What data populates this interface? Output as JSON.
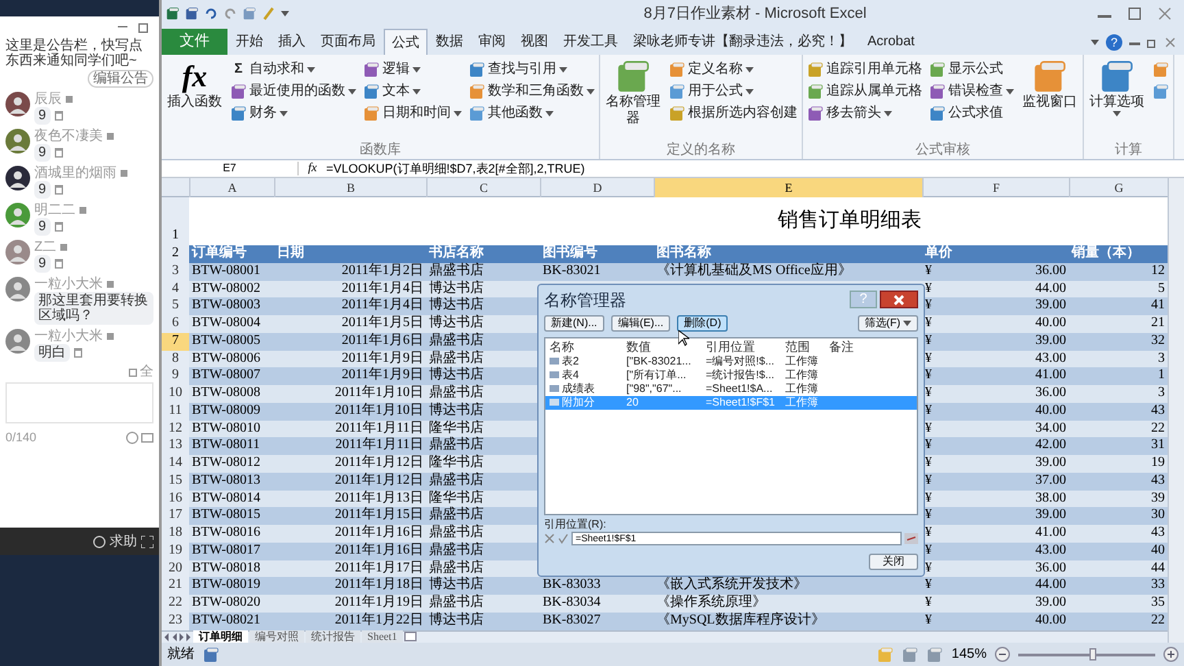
{
  "chat": {
    "announcement": "这里是公告栏，快写点东西来通知同学们吧~",
    "edit_button": "编辑公告",
    "messages": [
      {
        "name": "辰辰",
        "text": "9",
        "deletable": true
      },
      {
        "name": "夜色不凄美",
        "text": "9",
        "deletable": true
      },
      {
        "name": "酒城里的烟雨",
        "text": "9",
        "deletable": true
      },
      {
        "name": "明二二",
        "text": "9",
        "deletable": true
      },
      {
        "name": "Z二",
        "text": "9",
        "deletable": true
      },
      {
        "name": "一粒小大米",
        "text": "那这里套用要转换区域吗？",
        "deletable": false
      },
      {
        "name": "一粒小大米",
        "text": "明白",
        "deletable": true
      }
    ],
    "all_checked": false,
    "all_label": "全",
    "counter": "0/140",
    "help": "求助"
  },
  "excel": {
    "title": "8月7日作业素材 - Microsoft Excel",
    "file_tab": "文件",
    "tabs": [
      {
        "label": "开始",
        "selected": false
      },
      {
        "label": "插入",
        "selected": false
      },
      {
        "label": "页面布局",
        "selected": false
      },
      {
        "label": "公式",
        "selected": true
      },
      {
        "label": "数据",
        "selected": false
      },
      {
        "label": "审阅",
        "selected": false
      },
      {
        "label": "视图",
        "selected": false
      },
      {
        "label": "开发工具",
        "selected": false
      },
      {
        "label": "梁咏老师专讲【翻录违法，必究！】",
        "selected": false
      },
      {
        "label": "Acrobat",
        "selected": false
      }
    ],
    "help_glyph": "?",
    "ribbon": [
      {
        "label": "函数库",
        "items": [
          {
            "kind": "big",
            "label": "插入函数",
            "glyph": "fx",
            "dropdown": false
          },
          {
            "kind": "column",
            "items": [
              {
                "label": "自动求和",
                "glyph": "Σ",
                "dropdown": true
              },
              {
                "label": "最近使用的函数",
                "dropdown": true
              },
              {
                "label": "财务",
                "dropdown": true
              }
            ]
          },
          {
            "kind": "column",
            "items": [
              {
                "label": "逻辑",
                "dropdown": true
              },
              {
                "label": "文本",
                "dropdown": true
              },
              {
                "label": "日期和时间",
                "dropdown": true
              }
            ]
          },
          {
            "kind": "column",
            "items": [
              {
                "label": "查找与引用",
                "dropdown": true
              },
              {
                "label": "数学和三角函数",
                "dropdown": true
              },
              {
                "label": "其他函数",
                "dropdown": true
              }
            ]
          }
        ]
      },
      {
        "label": "定义的名称",
        "items": [
          {
            "kind": "big",
            "label": "名称管理器",
            "dropdown": false
          },
          {
            "kind": "column",
            "items": [
              {
                "label": "定义名称",
                "dropdown": true
              },
              {
                "label": "用于公式",
                "dropdown": true
              },
              {
                "label": "根据所选内容创建",
                "dropdown": false
              }
            ]
          }
        ]
      },
      {
        "label": "公式审核",
        "items": [
          {
            "kind": "column",
            "items": [
              {
                "label": "追踪引用单元格",
                "dropdown": false
              },
              {
                "label": "追踪从属单元格",
                "dropdown": false
              },
              {
                "label": "移去箭头",
                "dropdown": true
              }
            ]
          },
          {
            "kind": "column",
            "items": [
              {
                "label": "显示公式",
                "dropdown": false
              },
              {
                "label": "错误检查",
                "dropdown": true
              },
              {
                "label": "公式求值",
                "dropdown": false
              }
            ]
          },
          {
            "kind": "big",
            "label": "监视窗口",
            "dropdown": false
          }
        ]
      },
      {
        "label": "计算",
        "items": [
          {
            "kind": "big",
            "label": "计算选项",
            "dropdown": true
          },
          {
            "kind": "column",
            "items": [
              {
                "dropdown": false
              },
              {
                "dropdown": false
              }
            ]
          }
        ]
      }
    ],
    "name_box": "E7",
    "fx": "fx",
    "formula": "=VLOOKUP(订单明细!$D7,表2[#全部],2,TRUE)",
    "columns": [
      {
        "label": "A",
        "selected": false
      },
      {
        "label": "B",
        "selected": false
      },
      {
        "label": "C",
        "selected": false
      },
      {
        "label": "D",
        "selected": false
      },
      {
        "label": "E",
        "selected": true
      },
      {
        "label": "F",
        "selected": false
      },
      {
        "label": "G",
        "selected": false
      }
    ],
    "title_row_num": "1",
    "header_row_num": "2",
    "sheet_title": "销售订单明细表",
    "headers": [
      "订单编号",
      "日期",
      "书店名称",
      "图书编号",
      "图书名称",
      "单价",
      "销量（本）"
    ],
    "rows": [
      {
        "num": "3",
        "selected": false,
        "cells": [
          "BTW-08001",
          "2011年1月2日",
          "鼎盛书店",
          "BK-83021",
          "《计算机基础及MS Office应用》",
          "¥",
          "36.00",
          "12"
        ]
      },
      {
        "num": "4",
        "selected": false,
        "cells": [
          "BTW-08002",
          "2011年1月4日",
          "博达书店",
          null,
          null,
          "¥",
          "44.00",
          "5"
        ]
      },
      {
        "num": "5",
        "selected": false,
        "cells": [
          "BTW-08003",
          "2011年1月4日",
          "博达书店",
          null,
          null,
          "¥",
          "39.00",
          "41"
        ]
      },
      {
        "num": "6",
        "selected": false,
        "cells": [
          "BTW-08004",
          "2011年1月5日",
          "博达书店",
          null,
          null,
          "¥",
          "40.00",
          "21"
        ]
      },
      {
        "num": "7",
        "selected": true,
        "cells": [
          "BTW-08005",
          "2011年1月6日",
          "鼎盛书店",
          null,
          null,
          "¥",
          "39.00",
          "32"
        ]
      },
      {
        "num": "8",
        "selected": false,
        "cells": [
          "BTW-08006",
          "2011年1月9日",
          "鼎盛书店",
          null,
          null,
          "¥",
          "43.00",
          "3"
        ]
      },
      {
        "num": "9",
        "selected": false,
        "cells": [
          "BTW-08007",
          "2011年1月9日",
          "博达书店",
          null,
          null,
          "¥",
          "41.00",
          "1"
        ]
      },
      {
        "num": "10",
        "selected": false,
        "cells": [
          "BTW-08008",
          "2011年1月10日",
          "鼎盛书店",
          null,
          null,
          "¥",
          "36.00",
          "3"
        ]
      },
      {
        "num": "11",
        "selected": false,
        "cells": [
          "BTW-08009",
          "2011年1月10日",
          "博达书店",
          null,
          null,
          "¥",
          "40.00",
          "43"
        ]
      },
      {
        "num": "12",
        "selected": false,
        "cells": [
          "BTW-08010",
          "2011年1月11日",
          "隆华书店",
          null,
          null,
          "¥",
          "34.00",
          "22"
        ]
      },
      {
        "num": "13",
        "selected": false,
        "cells": [
          "BTW-08011",
          "2011年1月11日",
          "鼎盛书店",
          null,
          null,
          "¥",
          "42.00",
          "31"
        ]
      },
      {
        "num": "14",
        "selected": false,
        "cells": [
          "BTW-08012",
          "2011年1月12日",
          "隆华书店",
          null,
          null,
          "¥",
          "39.00",
          "19"
        ]
      },
      {
        "num": "15",
        "selected": false,
        "cells": [
          "BTW-08013",
          "2011年1月12日",
          "鼎盛书店",
          null,
          null,
          "¥",
          "37.00",
          "43"
        ]
      },
      {
        "num": "16",
        "selected": false,
        "cells": [
          "BTW-08014",
          "2011年1月13日",
          "隆华书店",
          null,
          null,
          "¥",
          "38.00",
          "39"
        ]
      },
      {
        "num": "17",
        "selected": false,
        "cells": [
          "BTW-08015",
          "2011年1月15日",
          "鼎盛书店",
          null,
          null,
          "¥",
          "39.00",
          "30"
        ]
      },
      {
        "num": "18",
        "selected": false,
        "cells": [
          "BTW-08016",
          "2011年1月16日",
          "鼎盛书店",
          null,
          null,
          "¥",
          "41.00",
          "43"
        ]
      },
      {
        "num": "19",
        "selected": false,
        "cells": [
          "BTW-08017",
          "2011年1月16日",
          "鼎盛书店",
          null,
          null,
          "¥",
          "43.00",
          "40"
        ]
      },
      {
        "num": "20",
        "selected": false,
        "cells": [
          "BTW-08018",
          "2011年1月17日",
          "鼎盛书店",
          null,
          null,
          "¥",
          "36.00",
          "44"
        ]
      },
      {
        "num": "21",
        "selected": false,
        "cells": [
          "BTW-08019",
          "2011年1月18日",
          "博达书店",
          "BK-83033",
          "《嵌入式系统开发技术》",
          "¥",
          "44.00",
          "33"
        ]
      },
      {
        "num": "22",
        "selected": false,
        "cells": [
          "BTW-08020",
          "2011年1月19日",
          "鼎盛书店",
          "BK-83034",
          "《操作系统原理》",
          "¥",
          "39.00",
          "35"
        ]
      },
      {
        "num": "23",
        "selected": false,
        "cells": [
          "BTW-08021",
          "2011年1月22日",
          "博达书店",
          "BK-83027",
          "《MySQL数据库程序设计》",
          "¥",
          "40.00",
          "22"
        ]
      }
    ],
    "dialog": {
      "title": "名称管理器",
      "help": "?",
      "buttons": [
        {
          "label": "新建(N)...",
          "hover": false
        },
        {
          "label": "编辑(E)...",
          "hover": false
        },
        {
          "label": "删除(D)",
          "hover": true
        }
      ],
      "filter": "筛选(F)",
      "columns": [
        "名称",
        "数值",
        "引用位置",
        "范围",
        "备注"
      ],
      "rows": [
        {
          "name": "表2",
          "value": "[\"BK-83021...",
          "ref": "=编号对照!$...",
          "scope": "工作簿",
          "selected": false
        },
        {
          "name": "表4",
          "value": "[\"所有订单...",
          "ref": "=统计报告!$...",
          "scope": "工作簿",
          "selected": false
        },
        {
          "name": "成绩表",
          "value": "[\"98\",\"67\"...",
          "ref": "=Sheet1!$A...",
          "scope": "工作簿",
          "selected": false
        },
        {
          "name": "附加分",
          "value": "20",
          "ref": "=Sheet1!$F$1",
          "scope": "工作簿",
          "selected": true
        }
      ],
      "ref_label": "引用位置(R):",
      "ref_value": "=Sheet1!$F$1",
      "close": "关闭"
    },
    "sheet_tabs": [
      {
        "label": "订单明细",
        "selected": true
      },
      {
        "label": "编号对照",
        "selected": false
      },
      {
        "label": "统计报告",
        "selected": false
      },
      {
        "label": "Sheet1",
        "selected": false
      }
    ],
    "status": "就绪",
    "zoom": "145%",
    "zoom_slider": {
      "level": 0.55
    }
  }
}
